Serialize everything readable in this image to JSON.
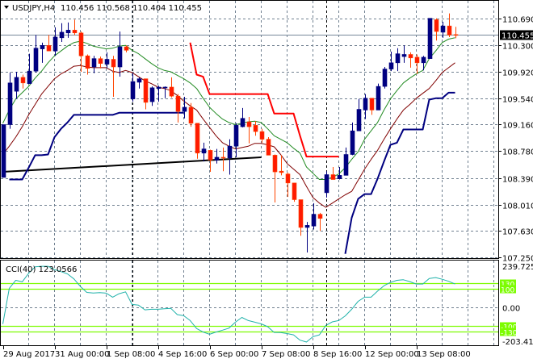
{
  "header": {
    "symbol": "USDJPY,H4",
    "ohlc": "110.456 110.568 110.404 110.455",
    "cci_label": "CCI(40) 123.0566"
  },
  "colors": {
    "bull": "#000080",
    "bear": "#ff1a00",
    "bear_wick": "#ff4500",
    "ma_fast": "#228b22",
    "ma_slow": "#800000",
    "lower_band": "#000080",
    "upper_stop": "#ff0000",
    "trendline": "#000000",
    "cci_line": "#20b2aa",
    "cci_levels": "#7cfc00",
    "grid": "#708090"
  },
  "chart_data": [
    {
      "type": "candlestick",
      "title": "USDJPY,H4",
      "ylim": [
        107.25,
        110.69
      ],
      "y_ticks": [
        "110.690",
        "110.300",
        "109.920",
        "109.540",
        "109.160",
        "108.780",
        "108.390",
        "108.010",
        "107.630",
        "107.250"
      ],
      "current_price": "110.455",
      "x_labels": [
        {
          "label": "29 Aug 2017",
          "index": 0
        },
        {
          "label": "31 Aug 00:00",
          "index": 8
        },
        {
          "label": "1 Sep 08:00",
          "index": 16
        },
        {
          "label": "4 Sep 16:00",
          "index": 24
        },
        {
          "label": "6 Sep 00:00",
          "index": 32
        },
        {
          "label": "7 Sep 08:00",
          "index": 40
        },
        {
          "label": "8 Sep 16:00",
          "index": 48
        },
        {
          "label": "12 Sep 00:00",
          "index": 56
        },
        {
          "label": "13 Sep 08:00",
          "index": 64
        }
      ],
      "day_separators": [
        20,
        50
      ],
      "candles_ohlc": [
        [
          108.4,
          109.16,
          108.4,
          109.16
        ],
        [
          109.16,
          109.91,
          109.1,
          109.76
        ],
        [
          109.64,
          109.92,
          109.53,
          109.84
        ],
        [
          109.84,
          109.88,
          109.68,
          109.76
        ],
        [
          109.75,
          110.18,
          109.75,
          109.93
        ],
        [
          109.93,
          110.45,
          109.91,
          110.26
        ],
        [
          110.25,
          110.34,
          110.05,
          110.3
        ],
        [
          110.3,
          110.45,
          110.22,
          110.22
        ],
        [
          110.22,
          110.56,
          110.15,
          110.42
        ],
        [
          110.41,
          110.62,
          110.35,
          110.49
        ],
        [
          110.48,
          110.63,
          110.41,
          110.52
        ],
        [
          110.52,
          110.67,
          110.45,
          110.48
        ],
        [
          110.48,
          110.5,
          109.92,
          110.15
        ],
        [
          110.15,
          110.17,
          109.88,
          109.97
        ],
        [
          109.99,
          110.15,
          109.9,
          110.11
        ],
        [
          110.11,
          110.14,
          109.97,
          110.04
        ],
        [
          110.03,
          110.2,
          109.97,
          110.1
        ],
        [
          110.1,
          110.15,
          109.56,
          109.99
        ],
        [
          109.99,
          110.5,
          109.85,
          110.28
        ],
        [
          110.28,
          110.3,
          110.2,
          110.23
        ],
        [
          109.53,
          109.9,
          109.49,
          109.78
        ],
        [
          109.77,
          109.84,
          109.68,
          109.82
        ],
        [
          109.82,
          109.82,
          109.38,
          109.48
        ],
        [
          109.49,
          109.71,
          109.43,
          109.69
        ],
        [
          109.68,
          109.72,
          109.49,
          109.7
        ],
        [
          109.69,
          109.71,
          109.54,
          109.7
        ],
        [
          109.7,
          109.84,
          109.55,
          109.57
        ],
        [
          109.57,
          109.6,
          109.19,
          109.35
        ],
        [
          109.35,
          109.56,
          109.25,
          109.41
        ],
        [
          109.41,
          109.47,
          109.13,
          109.18
        ],
        [
          109.18,
          109.18,
          108.67,
          108.75
        ],
        [
          108.75,
          108.9,
          108.63,
          108.81
        ],
        [
          108.79,
          108.8,
          108.48,
          108.65
        ],
        [
          108.65,
          108.81,
          108.6,
          108.69
        ],
        [
          108.69,
          108.83,
          108.49,
          108.68
        ],
        [
          108.68,
          108.95,
          108.44,
          108.85
        ],
        [
          108.85,
          109.18,
          108.69,
          109.15
        ],
        [
          109.13,
          109.4,
          109.12,
          109.25
        ],
        [
          109.2,
          109.27,
          108.89,
          109.13
        ],
        [
          109.15,
          109.21,
          109.0,
          109.06
        ],
        [
          109.06,
          109.1,
          108.9,
          108.95
        ],
        [
          108.95,
          108.98,
          108.72,
          108.72
        ],
        [
          108.72,
          108.73,
          108.04,
          108.48
        ],
        [
          108.49,
          108.72,
          108.43,
          108.47
        ],
        [
          108.45,
          108.47,
          108.12,
          108.32
        ],
        [
          108.32,
          108.32,
          108.05,
          108.08
        ],
        [
          108.08,
          108.08,
          107.56,
          107.68
        ],
        [
          107.68,
          107.76,
          107.32,
          107.71
        ],
        [
          107.7,
          108.03,
          107.65,
          107.87
        ],
        [
          107.87,
          107.89,
          107.63,
          107.81
        ],
        [
          108.18,
          108.49,
          108.11,
          108.44
        ],
        [
          108.44,
          108.55,
          108.37,
          108.37
        ],
        [
          108.38,
          108.55,
          108.37,
          108.43
        ],
        [
          108.43,
          108.83,
          108.43,
          108.73
        ],
        [
          108.73,
          109.19,
          108.72,
          109.07
        ],
        [
          109.07,
          109.53,
          109.07,
          109.38
        ],
        [
          109.37,
          109.6,
          109.24,
          109.54
        ],
        [
          109.54,
          109.54,
          109.3,
          109.37
        ],
        [
          109.37,
          109.75,
          109.37,
          109.71
        ],
        [
          109.71,
          109.99,
          109.68,
          109.96
        ],
        [
          109.96,
          110.21,
          109.93,
          110.05
        ],
        [
          110.05,
          110.26,
          109.93,
          110.18
        ],
        [
          110.14,
          110.3,
          110.05,
          110.17
        ],
        [
          110.17,
          110.2,
          109.98,
          110.12
        ],
        [
          110.13,
          110.17,
          109.89,
          110.05
        ],
        [
          110.05,
          110.15,
          109.94,
          110.13
        ],
        [
          110.11,
          110.69,
          110.11,
          110.69
        ],
        [
          110.67,
          110.69,
          110.37,
          110.5
        ],
        [
          110.49,
          110.64,
          110.41,
          110.58
        ],
        [
          110.58,
          110.76,
          110.42,
          110.45
        ],
        [
          110.456,
          110.568,
          110.404,
          110.455
        ]
      ],
      "ma_fast": [
        109.18,
        109.37,
        109.53,
        109.62,
        109.71,
        109.83,
        109.93,
        110.05,
        110.15,
        110.22,
        110.29,
        110.34,
        110.36,
        110.33,
        110.29,
        110.27,
        110.25,
        110.26,
        110.29,
        110.3,
        110.23,
        110.18,
        110.11,
        110.04,
        109.98,
        109.94,
        109.92,
        109.87,
        109.82,
        109.76,
        109.68,
        109.54,
        109.41,
        109.32,
        109.24,
        109.19,
        109.16,
        109.18,
        109.2,
        109.21,
        109.19,
        109.1,
        109.0,
        108.95,
        108.9,
        108.82,
        108.75,
        108.55,
        108.46,
        108.37,
        108.37,
        108.4,
        108.45,
        108.54,
        108.66,
        108.77,
        108.95,
        109.07,
        109.19,
        109.37,
        109.53,
        109.65,
        109.76,
        109.83,
        109.89,
        109.94,
        110.11,
        110.22,
        110.34,
        110.39,
        110.41
      ],
      "ma_slow": [
        108.73,
        108.85,
        108.98,
        109.13,
        109.3,
        109.45,
        109.6,
        109.71,
        109.82,
        109.89,
        109.94,
        110.0,
        110.01,
        109.99,
        109.98,
        109.98,
        109.98,
        109.93,
        109.91,
        109.94,
        109.91,
        109.85,
        109.79,
        109.75,
        109.7,
        109.68,
        109.65,
        109.58,
        109.5,
        109.43,
        109.37,
        109.24,
        109.12,
        109.0,
        108.9,
        108.85,
        108.81,
        108.83,
        108.85,
        108.89,
        108.89,
        108.87,
        108.84,
        108.73,
        108.6,
        108.52,
        108.44,
        108.27,
        108.11,
        108.03,
        107.97,
        108.03,
        108.09,
        108.15,
        108.2,
        108.36,
        108.52,
        108.66,
        108.79,
        108.95,
        109.1,
        109.24,
        109.37,
        109.45,
        109.54,
        109.61,
        109.68,
        109.79,
        109.91,
        109.98,
        110.05
      ],
      "lower_band": [
        null,
        108.37,
        108.37,
        108.37,
        108.54,
        108.72,
        108.72,
        108.73,
        108.98,
        109.1,
        109.19,
        109.3,
        109.3,
        109.3,
        109.3,
        109.3,
        109.3,
        109.3,
        109.33,
        109.33,
        109.33,
        109.33,
        109.33,
        109.33,
        109.33,
        109.33,
        109.33,
        109.33,
        109.33,
        null,
        null,
        null,
        null,
        null,
        null,
        null,
        null,
        null,
        null,
        null,
        null,
        null,
        null,
        null,
        null,
        null,
        null,
        null,
        null,
        null,
        null,
        null,
        null,
        107.3,
        107.82,
        108.09,
        108.16,
        108.16,
        108.38,
        108.63,
        108.87,
        108.9,
        109.09,
        109.09,
        109.09,
        109.09,
        109.52,
        109.54,
        109.54,
        109.62,
        109.62
      ],
      "upper_stop": [
        null,
        null,
        null,
        null,
        null,
        null,
        null,
        null,
        null,
        null,
        null,
        null,
        null,
        null,
        null,
        null,
        null,
        null,
        null,
        null,
        null,
        null,
        null,
        null,
        null,
        null,
        null,
        null,
        null,
        110.34,
        109.88,
        109.85,
        109.6,
        109.6,
        109.6,
        109.6,
        109.6,
        109.6,
        109.6,
        109.6,
        109.6,
        109.6,
        109.32,
        109.32,
        109.32,
        109.32,
        109.0,
        108.7,
        108.7,
        108.7,
        108.7,
        108.7,
        108.7,
        null,
        null,
        null,
        null,
        null,
        null,
        null,
        null,
        null,
        null,
        null,
        null,
        null,
        null,
        null,
        null,
        null,
        null
      ],
      "trendline": {
        "start_index": 0,
        "start_price": 108.48,
        "end_index": 40,
        "end_price": 108.69
      }
    },
    {
      "type": "line",
      "title": "CCI(40)",
      "current_value": "123.0566",
      "ylim": [
        -203.4156,
        239.7251
      ],
      "y_labels": {
        "max": "239.7251",
        "zero": "0.00",
        "min": "-203.4156"
      },
      "levels": [
        {
          "value": 130,
          "label": "130"
        },
        {
          "value": 100,
          "label": "100"
        },
        {
          "value": -100,
          "label": "-100"
        },
        {
          "value": -130,
          "label": "-130"
        }
      ],
      "values": [
        -90,
        103,
        146,
        138,
        184,
        219,
        222,
        222,
        204,
        193,
        181,
        154,
        113,
        81,
        78,
        80,
        77,
        55,
        74,
        84,
        16,
        12,
        -13,
        -10,
        -10,
        -7,
        -5,
        -39,
        -45,
        -71,
        -114,
        -133,
        -145,
        -133,
        -123,
        -112,
        -80,
        -54,
        -71,
        -80,
        -89,
        -104,
        -135,
        -136,
        -141,
        -148,
        -177,
        -187,
        -158,
        -148,
        -97,
        -78,
        -71,
        -46,
        -10,
        33,
        55,
        55,
        88,
        117,
        135,
        146,
        149,
        139,
        126,
        126,
        156,
        161,
        152,
        141,
        126
      ]
    }
  ]
}
